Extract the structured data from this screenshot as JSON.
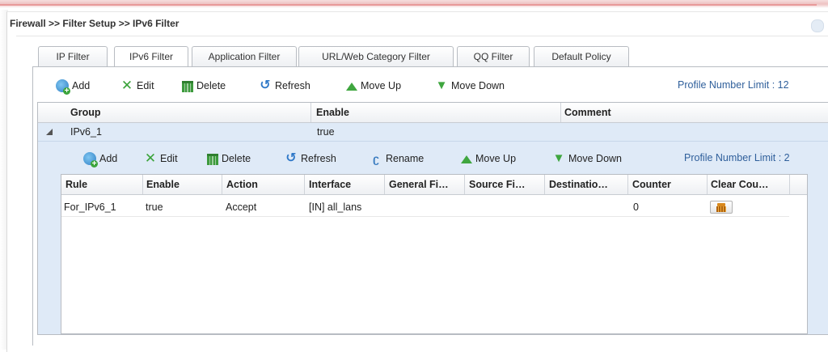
{
  "breadcrumb": "Firewall >> Filter Setup >> IPv6 Filter",
  "tabs": [
    {
      "label": "IP Filter",
      "active": false
    },
    {
      "label": "IPv6 Filter",
      "active": true
    },
    {
      "label": "Application Filter",
      "active": false
    },
    {
      "label": "URL/Web Category Filter",
      "active": false
    },
    {
      "label": "QQ Filter",
      "active": false
    },
    {
      "label": "Default Policy",
      "active": false
    }
  ],
  "toolbar": {
    "add": "Add",
    "edit": "Edit",
    "delete": "Delete",
    "refresh": "Refresh",
    "move_up": "Move Up",
    "move_down": "Move Down",
    "limit": "Profile Number Limit : 12"
  },
  "group_grid": {
    "headers": {
      "group": "Group",
      "enable": "Enable",
      "comment": "Comment"
    },
    "rows": [
      {
        "group": "IPv6_1",
        "enable": "true",
        "comment": ""
      }
    ]
  },
  "inner_toolbar": {
    "add": "Add",
    "edit": "Edit",
    "delete": "Delete",
    "refresh": "Refresh",
    "rename": "Rename",
    "move_up": "Move Up",
    "move_down": "Move Down",
    "limit": "Profile Number Limit : 2"
  },
  "rule_grid": {
    "headers": {
      "rule": "Rule",
      "enable": "Enable",
      "action": "Action",
      "interface": "Interface",
      "general_filter": "General Fi…",
      "source_filter": "Source Fi…",
      "destination": "Destinatio…",
      "counter": "Counter",
      "clear_counter": "Clear Cou…"
    },
    "rows": [
      {
        "rule": "For_IPv6_1",
        "enable": "true",
        "action": "Accept",
        "interface": "[IN] all_lans",
        "general_filter": "",
        "source_filter": "",
        "destination": "",
        "counter": "0"
      }
    ]
  },
  "icons": {
    "add": "add-icon",
    "edit": "edit-icon",
    "delete": "delete-icon",
    "refresh": "refresh-icon",
    "rename": "rename-icon",
    "move_up": "move-up-icon",
    "move_down": "move-down-icon",
    "clear_counter": "broom-icon"
  },
  "colors": {
    "selected_row": "#dfeaf7",
    "limit_text": "#2f5f9b",
    "accent_green": "#3fa63f"
  }
}
